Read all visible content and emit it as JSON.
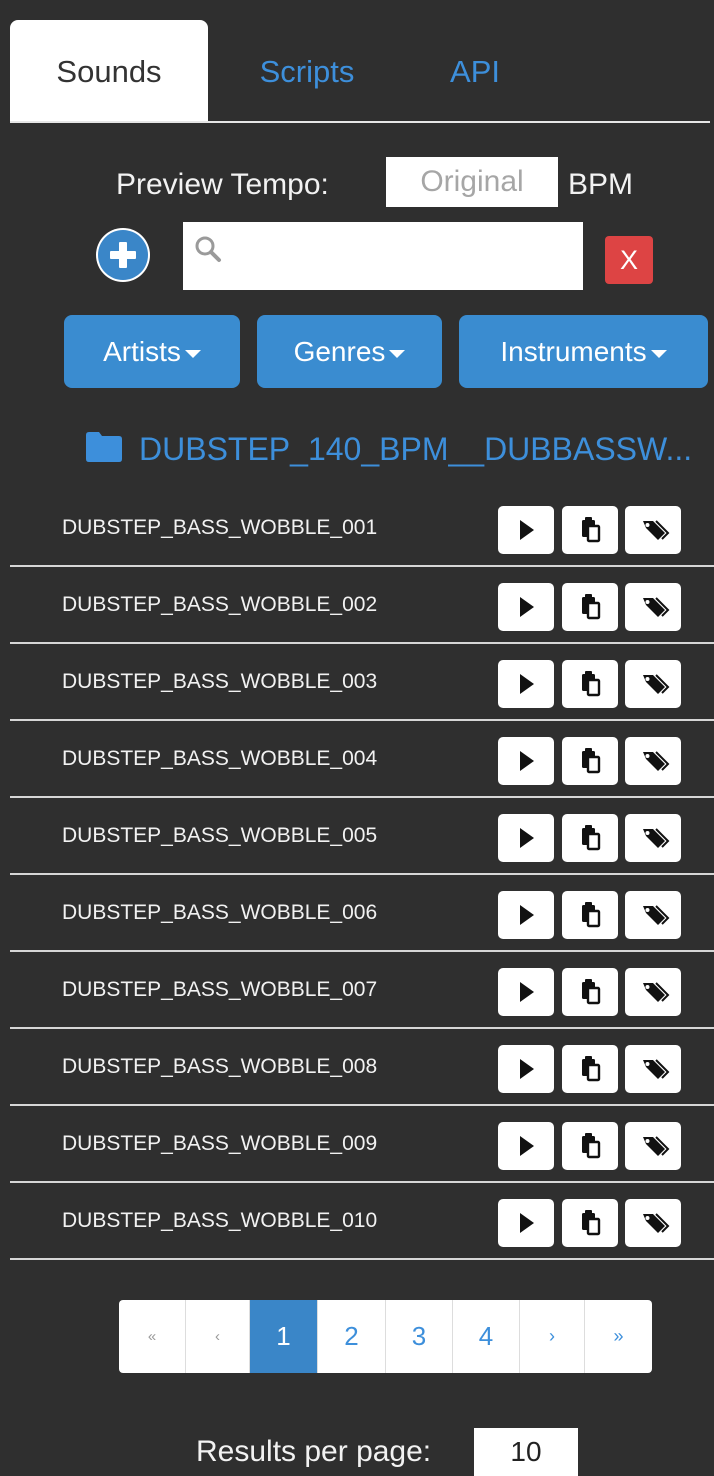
{
  "tabs": [
    {
      "label": "Sounds",
      "active": true
    },
    {
      "label": "Scripts",
      "active": false
    },
    {
      "label": "API",
      "active": false
    }
  ],
  "tempo": {
    "label": "Preview Tempo:",
    "placeholder": "Original",
    "unit": "BPM"
  },
  "search": {
    "placeholder": "",
    "clear_label": "X",
    "add_icon": "plus-circle-icon",
    "search_icon": "magnifier-icon"
  },
  "filters": {
    "artists": "Artists",
    "genres": "Genres",
    "instruments": "Instruments"
  },
  "folder": {
    "name": "DUBSTEP_140_BPM__DUBBASSW...",
    "icon": "folder-icon"
  },
  "sounds": [
    {
      "name": "DUBSTEP_BASS_WOBBLE_001"
    },
    {
      "name": "DUBSTEP_BASS_WOBBLE_002"
    },
    {
      "name": "DUBSTEP_BASS_WOBBLE_003"
    },
    {
      "name": "DUBSTEP_BASS_WOBBLE_004"
    },
    {
      "name": "DUBSTEP_BASS_WOBBLE_005"
    },
    {
      "name": "DUBSTEP_BASS_WOBBLE_006"
    },
    {
      "name": "DUBSTEP_BASS_WOBBLE_007"
    },
    {
      "name": "DUBSTEP_BASS_WOBBLE_008"
    },
    {
      "name": "DUBSTEP_BASS_WOBBLE_009"
    },
    {
      "name": "DUBSTEP_BASS_WOBBLE_010"
    }
  ],
  "row_icons": [
    "play-icon",
    "clipboard-icon",
    "tag-icon"
  ],
  "pagination": {
    "first": "«",
    "prev": "‹",
    "pages": [
      "1",
      "2",
      "3",
      "4"
    ],
    "current": "1",
    "next": "›",
    "last": "»"
  },
  "results_per_page": {
    "label": "Results per page:",
    "value": "10"
  },
  "colors": {
    "background": "#2f2f2f",
    "accent": "#3a8cd0",
    "link": "#3d8fdb",
    "danger": "#dd4444",
    "text": "#f2f2f2"
  }
}
